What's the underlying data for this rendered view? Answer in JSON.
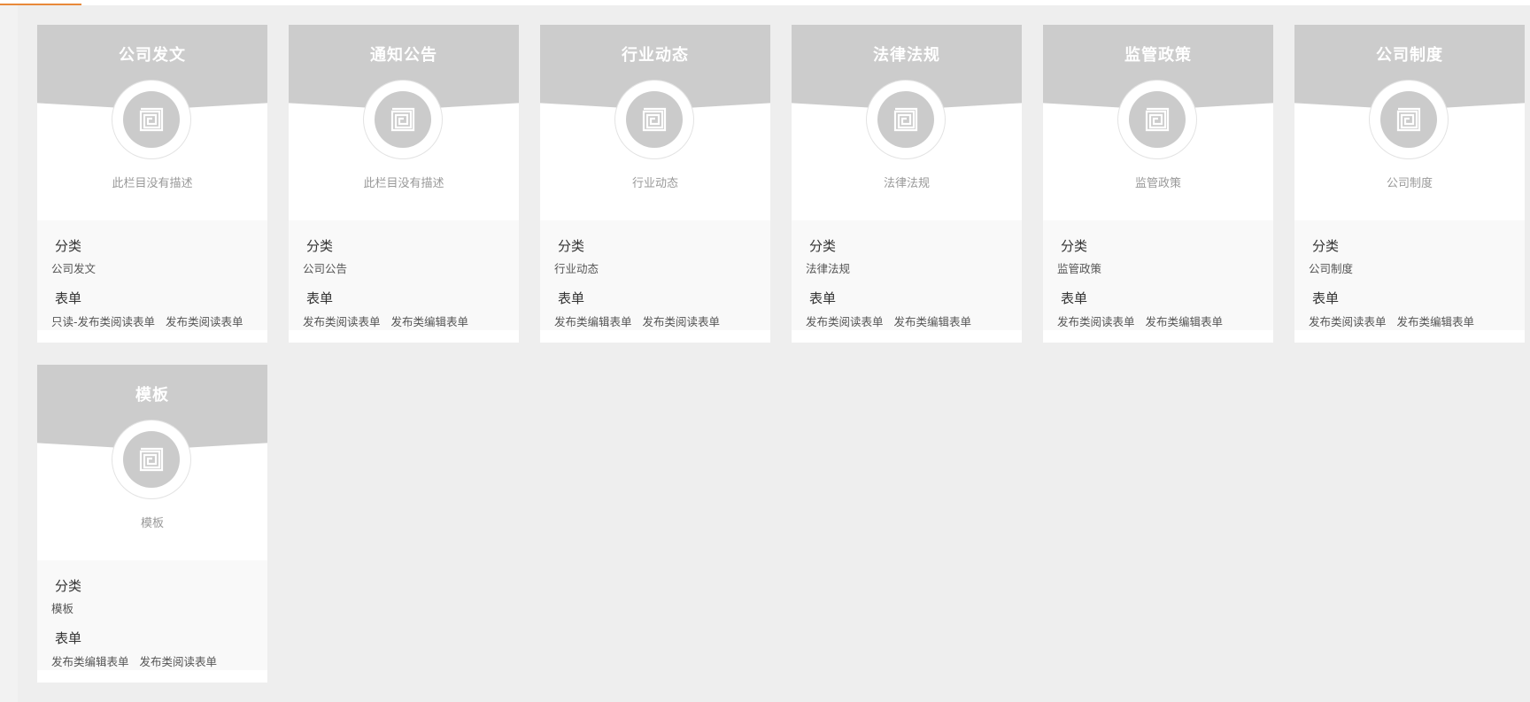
{
  "labels": {
    "category": "分类",
    "form": "表单"
  },
  "cards": [
    {
      "title": "公司发文",
      "description": "此栏目没有描述",
      "category": "公司发文",
      "forms": [
        "只读-发布类阅读表单",
        "发布类阅读表单"
      ]
    },
    {
      "title": "通知公告",
      "description": "此栏目没有描述",
      "category": "公司公告",
      "forms": [
        "发布类阅读表单",
        "发布类编辑表单"
      ]
    },
    {
      "title": "行业动态",
      "description": "行业动态",
      "category": "行业动态",
      "forms": [
        "发布类编辑表单",
        "发布类阅读表单"
      ]
    },
    {
      "title": "法律法规",
      "description": "法律法规",
      "category": "法律法规",
      "forms": [
        "发布类阅读表单",
        "发布类编辑表单"
      ]
    },
    {
      "title": "监管政策",
      "description": "监管政策",
      "category": "监管政策",
      "forms": [
        "发布类阅读表单",
        "发布类编辑表单"
      ]
    },
    {
      "title": "公司制度",
      "description": "公司制度",
      "category": "公司制度",
      "forms": [
        "发布类阅读表单",
        "发布类编辑表单"
      ]
    },
    {
      "title": "模板",
      "description": "模板",
      "category": "模板",
      "forms": [
        "发布类编辑表单",
        "发布类阅读表单"
      ]
    }
  ],
  "icons": {
    "card_icon": "column-spiral-icon"
  },
  "colors": {
    "accent": "#e8893a",
    "header_gray": "#cccccc"
  }
}
